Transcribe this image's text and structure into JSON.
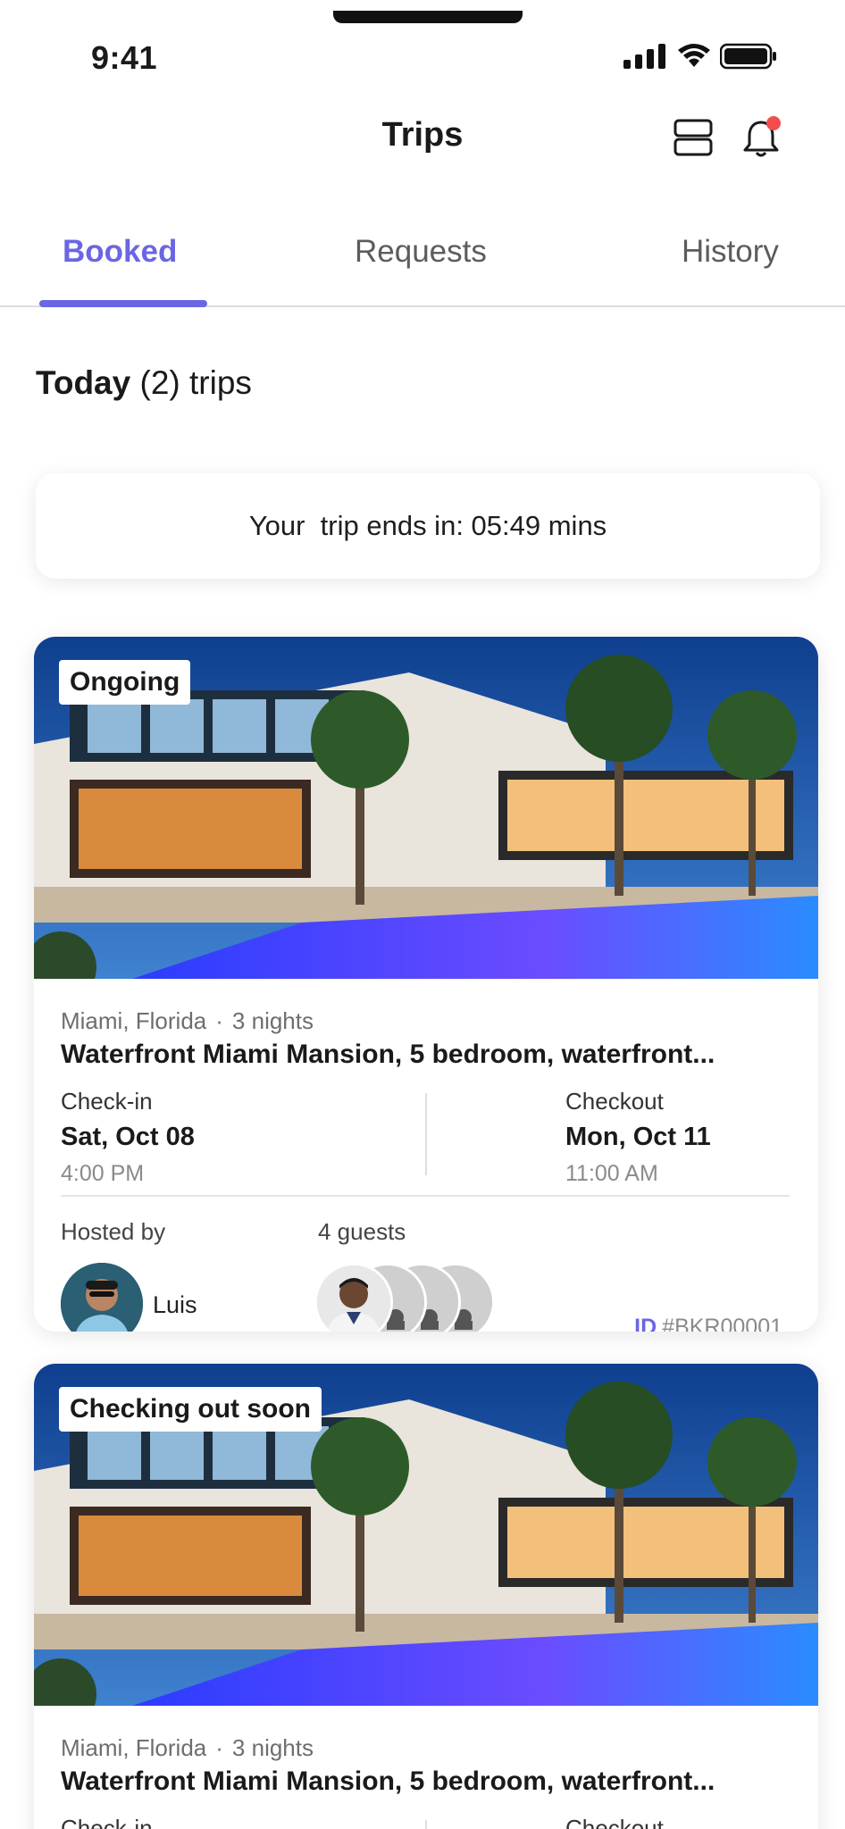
{
  "status_bar": {
    "time": "9:41"
  },
  "header": {
    "title": "Trips"
  },
  "tabs": [
    {
      "label": "Booked",
      "active": true
    },
    {
      "label": "Requests",
      "active": false
    },
    {
      "label": "History",
      "active": false
    }
  ],
  "section": {
    "strong": "Today",
    "count": "(2)",
    "suffix": "trips"
  },
  "timer": {
    "text": "Your  trip ends in: 05:49 mins"
  },
  "colors": {
    "accent": "#6a66e3",
    "notification": "#f24e4e"
  },
  "trips": [
    {
      "status": "Ongoing",
      "location": "Miami, Florida",
      "nights": "3 nights",
      "title": "Waterfront Miami Mansion, 5 bedroom, waterfront...",
      "checkin": {
        "label": "Check-in",
        "date": "Sat, Oct 08",
        "time": "4:00 PM"
      },
      "checkout": {
        "label": "Checkout",
        "date": "Mon, Oct 11",
        "time": "11:00 AM"
      },
      "host_label": "Hosted by",
      "host_name": "Luis",
      "guests": "4 guests",
      "id_prefix": "ID",
      "id_value": "#BKR00001"
    },
    {
      "status": "Checking out soon",
      "location": "Miami, Florida",
      "nights": "3 nights",
      "title": "Waterfront Miami Mansion, 5 bedroom, waterfront...",
      "checkin": {
        "label": "Check-in"
      },
      "checkout": {
        "label": "Checkout"
      }
    }
  ]
}
